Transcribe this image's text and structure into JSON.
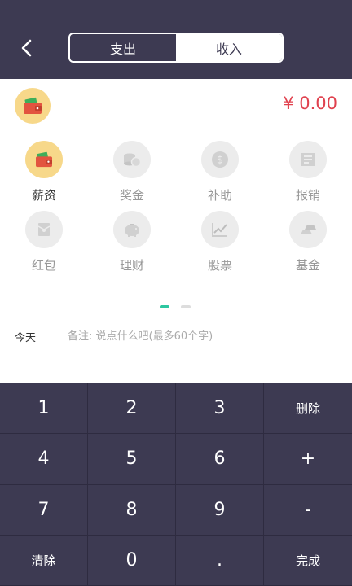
{
  "header": {
    "tabs": [
      {
        "label": "支出",
        "active": false
      },
      {
        "label": "收入",
        "active": true
      }
    ]
  },
  "amount": "¥ 0.00",
  "categories": [
    {
      "label": "薪资",
      "icon": "wallet-icon",
      "active": true
    },
    {
      "label": "奖金",
      "icon": "coins-icon",
      "active": false
    },
    {
      "label": "补助",
      "icon": "dollar-coin-icon",
      "active": false
    },
    {
      "label": "报销",
      "icon": "receipt-icon",
      "active": false
    },
    {
      "label": "红包",
      "icon": "red-envelope-icon",
      "active": false
    },
    {
      "label": "理财",
      "icon": "piggy-bank-icon",
      "active": false
    },
    {
      "label": "股票",
      "icon": "stock-chart-icon",
      "active": false
    },
    {
      "label": "基金",
      "icon": "gold-bars-icon",
      "active": false
    }
  ],
  "pager": {
    "pages": 2,
    "current": 1
  },
  "note": {
    "date_label": "今天",
    "placeholder": "备注: 说点什么吧(最多60个字)",
    "value": ""
  },
  "keypad": {
    "keys": [
      "1",
      "2",
      "3",
      "删除",
      "4",
      "5",
      "6",
      "+",
      "7",
      "8",
      "9",
      "-",
      "清除",
      "0",
      ".",
      "完成"
    ]
  },
  "colors": {
    "header_bg": "#3d3a52",
    "accent_green": "#2dc7a0",
    "amount_red": "#e0414e",
    "active_icon_bg": "#f7d88a"
  }
}
